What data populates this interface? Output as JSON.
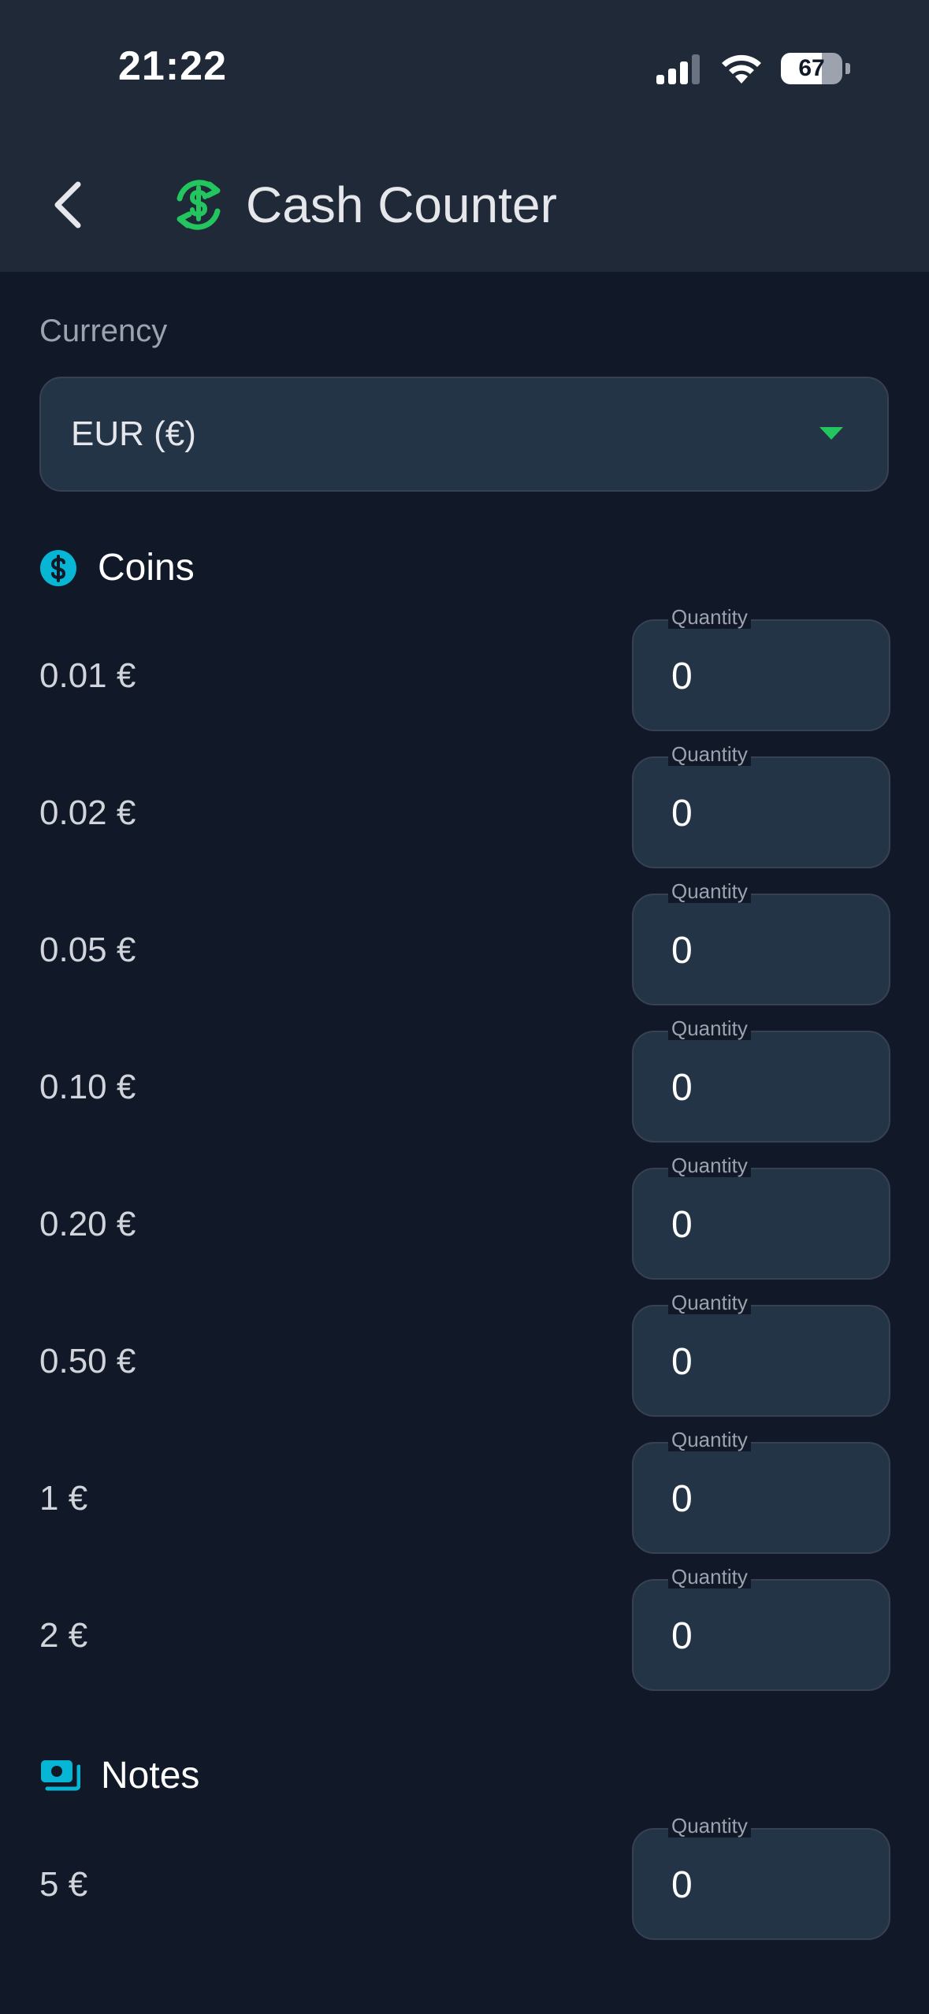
{
  "status_bar": {
    "time": "21:22",
    "battery_level": "67"
  },
  "header": {
    "title": "Cash Counter",
    "back_icon": "chevron-left-icon",
    "logo_icon": "currency-exchange-icon"
  },
  "currency": {
    "label": "Currency",
    "selected": "EUR (€)"
  },
  "coins": {
    "title": "Coins",
    "icon": "coin-dollar-icon",
    "rows": [
      {
        "label": "0.01 €",
        "field_label": "Quantity",
        "value": "0"
      },
      {
        "label": "0.02 €",
        "field_label": "Quantity",
        "value": "0"
      },
      {
        "label": "0.05 €",
        "field_label": "Quantity",
        "value": "0"
      },
      {
        "label": "0.10 €",
        "field_label": "Quantity",
        "value": "0"
      },
      {
        "label": "0.20 €",
        "field_label": "Quantity",
        "value": "0"
      },
      {
        "label": "0.50 €",
        "field_label": "Quantity",
        "value": "0"
      },
      {
        "label": "1 €",
        "field_label": "Quantity",
        "value": "0"
      },
      {
        "label": "2 €",
        "field_label": "Quantity",
        "value": "0"
      }
    ]
  },
  "notes": {
    "title": "Notes",
    "icon": "banknote-icon",
    "rows": [
      {
        "label": "5 €",
        "field_label": "Quantity",
        "value": "0"
      }
    ]
  },
  "colors": {
    "accent_green": "#22c55e",
    "accent_cyan": "#06b6d4",
    "background": "#111827",
    "header": "#1f2937",
    "field": "#243447"
  }
}
